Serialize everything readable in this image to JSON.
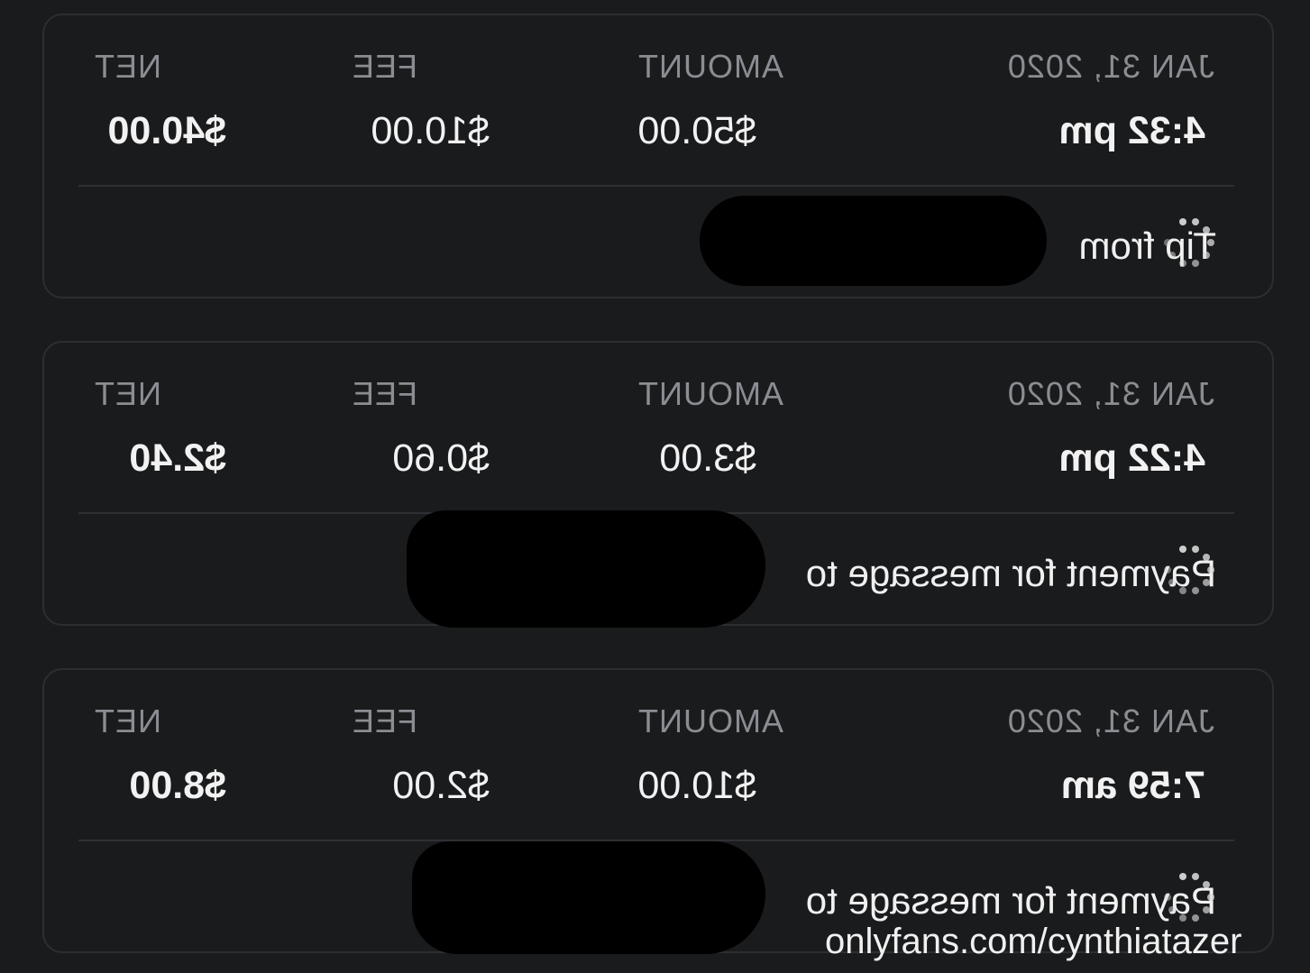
{
  "transactions": [
    {
      "date": "JAN 31, 2020",
      "time": "4:32 pm",
      "amount": "$50.00",
      "fee": "$10.00",
      "net": "$40.00",
      "description": "Tip from"
    },
    {
      "date": "JAN 31, 2020",
      "time": "4:22 pm",
      "amount": "$3.00",
      "fee": "$0.60",
      "net": "$2.40",
      "description": "Payment for message to"
    },
    {
      "date": "JAN 31, 2020",
      "time": "7:59 am",
      "amount": "$10.00",
      "fee": "$2.00",
      "net": "$8.00",
      "description": "Payment for message to"
    }
  ],
  "columns": {
    "amount": "AMOUNT",
    "fee": "FEE",
    "net": "NET"
  },
  "watermark": "onlyfans.com/cynthiatazer",
  "icons": {
    "status": "loading-spinner-icon"
  },
  "colors": {
    "background": "#1a1b1d",
    "card_border": "#2d2e31",
    "label": "#8b8d92",
    "value": "#f2f2f2"
  }
}
